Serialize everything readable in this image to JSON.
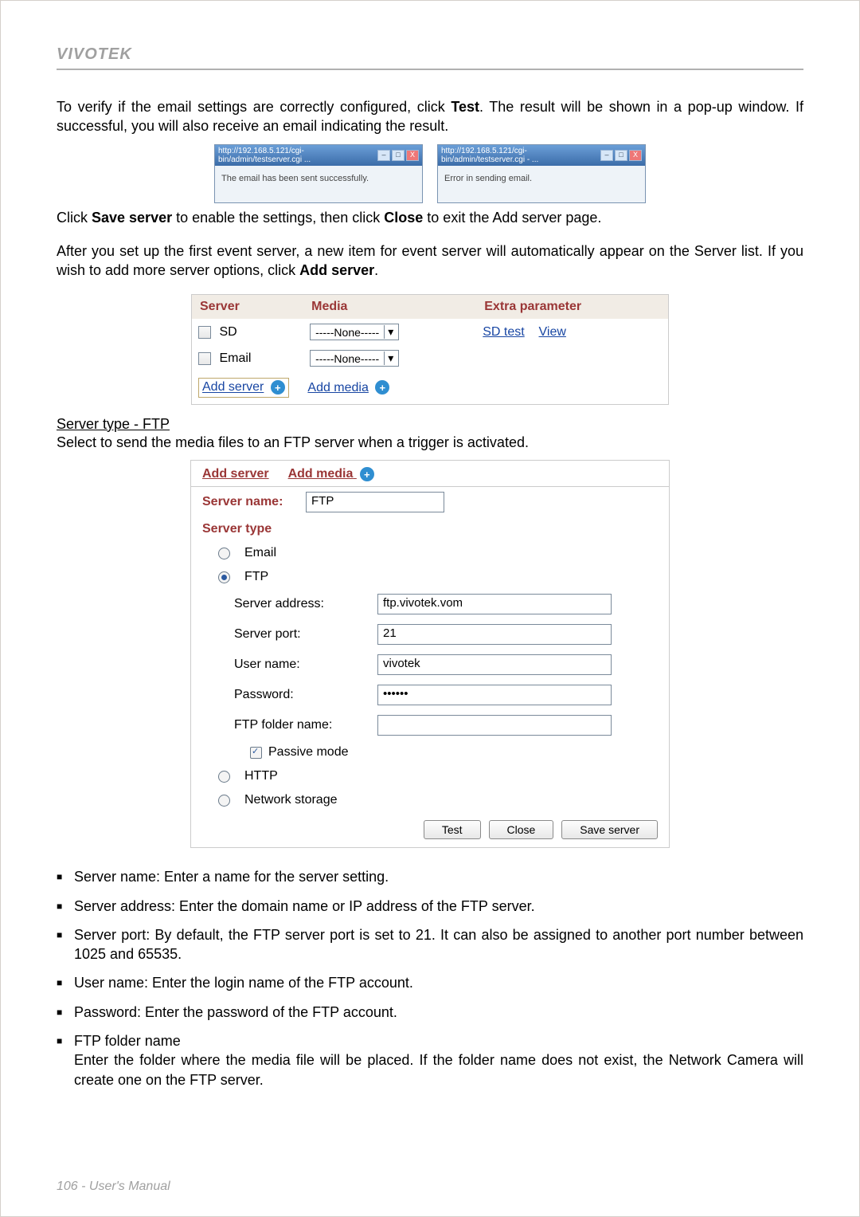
{
  "brand": "VIVOTEK",
  "intro1_a": "To verify if the email settings are correctly configured, click ",
  "intro1_b": "Test",
  "intro1_c": ". The result will be shown in a pop-up window. If successful, you will also receive an email indicating the result.",
  "popup_success": {
    "title": "http://192.168.5.121/cgi-bin/admin/testserver.cgi ...",
    "body": "The email has been sent successfully."
  },
  "popup_error": {
    "title": "http://192.168.5.121/cgi-bin/admin/testserver.cgi - ...",
    "body": "Error in sending email."
  },
  "after_test_a": "Click ",
  "after_test_b": "Save server",
  "after_test_c": " to enable the settings, then click ",
  "after_test_d": "Close",
  "after_test_e": " to exit the Add server page.",
  "auto_a": "After you set up the first event server, a new item for event server will automatically appear on the Server list. If you wish to add more server options, click ",
  "auto_b": "Add server",
  "auto_c": ".",
  "server_table": {
    "headers": {
      "server": "Server",
      "media": "Media",
      "extra": "Extra parameter"
    },
    "rows": [
      {
        "name": "SD",
        "media": "-----None-----",
        "extra1": "SD test",
        "extra2": "View"
      },
      {
        "name": "Email",
        "media": "-----None-----"
      }
    ],
    "add_server": "Add server",
    "add_media": "Add media"
  },
  "ftp_heading": "Server type - FTP",
  "ftp_desc": "Select to send the media files to an FTP server when a trigger is activated.",
  "ftp_form": {
    "tab_add_server": "Add server",
    "tab_add_media": "Add media",
    "server_name_label": "Server name:",
    "server_name_value": "FTP",
    "server_type_label": "Server type",
    "opt_email": "Email",
    "opt_ftp": "FTP",
    "opt_http": "HTTP",
    "opt_ns": "Network storage",
    "fields": {
      "addr_label": "Server address:",
      "addr_value": "ftp.vivotek.vom",
      "port_label": "Server port:",
      "port_value": "21",
      "user_label": "User name:",
      "user_value": "vivotek",
      "pass_label": "Password:",
      "pass_value": "••••••",
      "folder_label": "FTP folder name:",
      "folder_value": "",
      "passive_label": "Passive mode"
    },
    "btn_test": "Test",
    "btn_close": "Close",
    "btn_save": "Save server"
  },
  "bullets": {
    "b1": "Server name: Enter a name for the server setting.",
    "b2": "Server address: Enter the domain name or IP address of the FTP server.",
    "b3": "Server port: By default, the FTP server port is set to 21. It can also be assigned to another port number between 1025 and 65535.",
    "b4": "User name: Enter the login name of the FTP account.",
    "b5": "Password: Enter the password of the FTP account.",
    "b6a": "FTP folder name",
    "b6b": "Enter the folder where the media file will be placed. If the folder name does not exist, the Network Camera will create one on the FTP server."
  },
  "footer": "106 - User's Manual",
  "icons": {
    "min": "–",
    "max": "□",
    "close": "X",
    "chev": "▾",
    "plus": "+"
  }
}
